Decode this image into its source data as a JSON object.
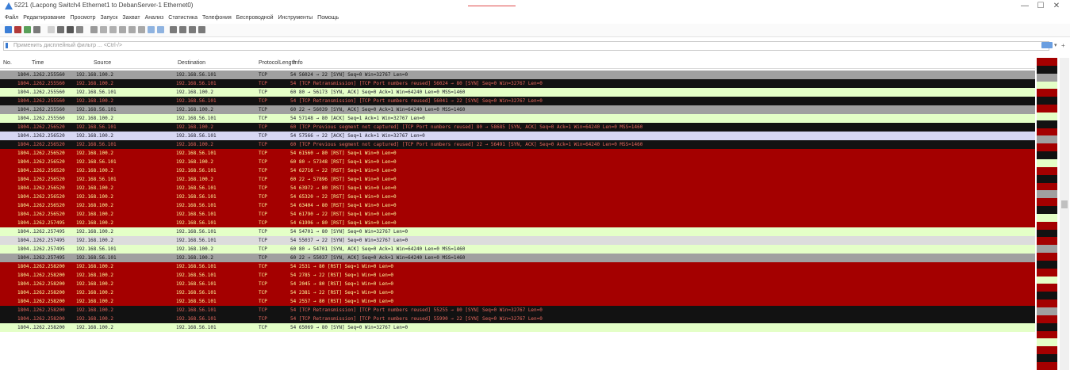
{
  "window": {
    "title": "5221 (Lacpong Switch4 Ethernet1 to DebanServer-1 Ethernet0)",
    "minimize": "—",
    "maximize": "☐",
    "close": "✕"
  },
  "menu": [
    "Файл",
    "Редактирование",
    "Просмотр",
    "Запуск",
    "Захват",
    "Анализ",
    "Статистика",
    "Телефония",
    "Беспроводной",
    "Инструменты",
    "Помощь"
  ],
  "filter": {
    "placeholder": "Применить дисплейный фильтр ... <Ctrl-/>",
    "apply_icon": "arrow-right-icon",
    "dropdown": "▾",
    "add": "+"
  },
  "columns": {
    "no": "No.",
    "time": "Time",
    "source": "Source",
    "destination": "Destination",
    "protocol": "Protocol",
    "length": "Length",
    "info": "Info"
  },
  "packets": [
    {
      "no": "1804..",
      "time": "1262.255560",
      "src": "192.168.100.2",
      "dst": "192.168.56.101",
      "proto": "TCP",
      "len": "",
      "info": "54 56024 → 22 [SYN] Seq=0 Win=32767 Len=0",
      "scheme": "gray"
    },
    {
      "no": "1804..",
      "time": "1262.255560",
      "src": "192.168.100.2",
      "dst": "192.168.56.101",
      "proto": "TCP",
      "len": "",
      "info": "54 [TCP Retransmission] [TCP Port numbers reused] 56024 → 80 [SYN] Seq=0 Win=32767 Len=0",
      "scheme": "black"
    },
    {
      "no": "1804..",
      "time": "1262.255560",
      "src": "192.168.56.101",
      "dst": "192.168.100.2",
      "proto": "TCP",
      "len": "",
      "info": "60 80 → 56173 [SYN, ACK] Seq=0 Ack=1 Win=64240 Len=0 MSS=1460",
      "scheme": "green"
    },
    {
      "no": "1804..",
      "time": "1262.255560",
      "src": "192.168.100.2",
      "dst": "192.168.56.101",
      "proto": "TCP",
      "len": "",
      "info": "54 [TCP Retransmission] [TCP Port numbers reused] 56041 → 22 [SYN] Seq=0 Win=32767 Len=0",
      "scheme": "black"
    },
    {
      "no": "1804..",
      "time": "1262.255560",
      "src": "192.168.56.101",
      "dst": "192.168.100.2",
      "proto": "TCP",
      "len": "",
      "info": "60 22 → 56039 [SYN, ACK] Seq=0 Ack=1 Win=64240 Len=0 MSS=1460",
      "scheme": "gray"
    },
    {
      "no": "1804..",
      "time": "1262.255560",
      "src": "192.168.100.2",
      "dst": "192.168.56.101",
      "proto": "TCP",
      "len": "",
      "info": "54 57148 → 80 [ACK] Seq=1 Ack=1 Win=32767 Len=0",
      "scheme": "green"
    },
    {
      "no": "1804..",
      "time": "1262.256520",
      "src": "192.168.56.101",
      "dst": "192.168.100.2",
      "proto": "TCP",
      "len": "",
      "info": "60 [TCP Previous segment not captured] [TCP Port numbers reused] 80 → 58685 [SYN, ACK] Seq=0 Ack=1 Win=64240 Len=0 MSS=1460",
      "scheme": "black"
    },
    {
      "no": "1804..",
      "time": "1262.256520",
      "src": "192.168.100.2",
      "dst": "192.168.56.101",
      "proto": "TCP",
      "len": "",
      "info": "54 57566 → 22 [ACK] Seq=1 Ack=1 Win=32767 Len=0",
      "scheme": "selected"
    },
    {
      "no": "1804..",
      "time": "1262.256520",
      "src": "192.168.56.101",
      "dst": "192.168.100.2",
      "proto": "TCP",
      "len": "",
      "info": "60 [TCP Previous segment not captured] [TCP Port numbers reused] 22 → 56491 [SYN, ACK] Seq=0 Ack=1 Win=64240 Len=0 MSS=1460",
      "scheme": "black"
    },
    {
      "no": "1804..",
      "time": "1262.256520",
      "src": "192.168.100.2",
      "dst": "192.168.56.101",
      "proto": "TCP",
      "len": "",
      "info": "54 61560 → 80 [RST] Seq=1 Win=0 Len=0",
      "scheme": "red"
    },
    {
      "no": "1804..",
      "time": "1262.256520",
      "src": "192.168.56.101",
      "dst": "192.168.100.2",
      "proto": "TCP",
      "len": "",
      "info": "60 80 → 57348 [RST] Seq=1 Win=0 Len=0",
      "scheme": "red"
    },
    {
      "no": "1804..",
      "time": "1262.256520",
      "src": "192.168.100.2",
      "dst": "192.168.56.101",
      "proto": "TCP",
      "len": "",
      "info": "54 62716 → 22 [RST] Seq=1 Win=0 Len=0",
      "scheme": "red"
    },
    {
      "no": "1804..",
      "time": "1262.256520",
      "src": "192.168.56.101",
      "dst": "192.168.100.2",
      "proto": "TCP",
      "len": "",
      "info": "60 22 → 57896 [RST] Seq=1 Win=0 Len=0",
      "scheme": "red"
    },
    {
      "no": "1804..",
      "time": "1262.256520",
      "src": "192.168.100.2",
      "dst": "192.168.56.101",
      "proto": "TCP",
      "len": "",
      "info": "54 63972 → 80 [RST] Seq=1 Win=0 Len=0",
      "scheme": "red"
    },
    {
      "no": "1804..",
      "time": "1262.256520",
      "src": "192.168.100.2",
      "dst": "192.168.56.101",
      "proto": "TCP",
      "len": "",
      "info": "54 65320 → 22 [RST] Seq=1 Win=0 Len=0",
      "scheme": "red"
    },
    {
      "no": "1804..",
      "time": "1262.256520",
      "src": "192.168.100.2",
      "dst": "192.168.56.101",
      "proto": "TCP",
      "len": "",
      "info": "54 63404 → 80 [RST] Seq=1 Win=0 Len=0",
      "scheme": "red"
    },
    {
      "no": "1804..",
      "time": "1262.256520",
      "src": "192.168.100.2",
      "dst": "192.168.56.101",
      "proto": "TCP",
      "len": "",
      "info": "54 61790 → 22 [RST] Seq=1 Win=0 Len=0",
      "scheme": "red"
    },
    {
      "no": "1804..",
      "time": "1262.257495",
      "src": "192.168.100.2",
      "dst": "192.168.56.101",
      "proto": "TCP",
      "len": "",
      "info": "54 61996 → 80 [RST] Seq=1 Win=0 Len=0",
      "scheme": "red"
    },
    {
      "no": "1804..",
      "time": "1262.257495",
      "src": "192.168.100.2",
      "dst": "192.168.56.101",
      "proto": "TCP",
      "len": "",
      "info": "54 54701 → 80 [SYN] Seq=0 Win=32767 Len=0",
      "scheme": "green"
    },
    {
      "no": "1804..",
      "time": "1262.257495",
      "src": "192.168.100.2",
      "dst": "192.168.56.101",
      "proto": "TCP",
      "len": "",
      "info": "54 55037 → 22 [SYN] Seq=0 Win=32767 Len=0",
      "scheme": "lightgray"
    },
    {
      "no": "1804..",
      "time": "1262.257495",
      "src": "192.168.56.101",
      "dst": "192.168.100.2",
      "proto": "TCP",
      "len": "",
      "info": "60 80 → 54701 [SYN, ACK] Seq=0 Ack=1 Win=64240 Len=0 MSS=1460",
      "scheme": "green"
    },
    {
      "no": "1804..",
      "time": "1262.257495",
      "src": "192.168.56.101",
      "dst": "192.168.100.2",
      "proto": "TCP",
      "len": "",
      "info": "60 22 → 55037 [SYN, ACK] Seq=0 Ack=1 Win=64240 Len=0 MSS=1460",
      "scheme": "gray"
    },
    {
      "no": "1804..",
      "time": "1262.258200",
      "src": "192.168.100.2",
      "dst": "192.168.56.101",
      "proto": "TCP",
      "len": "",
      "info": "54 2531 → 80 [RST] Seq=1 Win=0 Len=0",
      "scheme": "red"
    },
    {
      "no": "1804..",
      "time": "1262.258200",
      "src": "192.168.100.2",
      "dst": "192.168.56.101",
      "proto": "TCP",
      "len": "",
      "info": "54 2785 → 22 [RST] Seq=1 Win=0 Len=0",
      "scheme": "red"
    },
    {
      "no": "1804..",
      "time": "1262.258200",
      "src": "192.168.100.2",
      "dst": "192.168.56.101",
      "proto": "TCP",
      "len": "",
      "info": "54 2045 → 80 [RST] Seq=1 Win=0 Len=0",
      "scheme": "red"
    },
    {
      "no": "1804..",
      "time": "1262.258200",
      "src": "192.168.100.2",
      "dst": "192.168.56.101",
      "proto": "TCP",
      "len": "",
      "info": "54 2381 → 22 [RST] Seq=1 Win=0 Len=0",
      "scheme": "red"
    },
    {
      "no": "1804..",
      "time": "1262.258200",
      "src": "192.168.100.2",
      "dst": "192.168.56.101",
      "proto": "TCP",
      "len": "",
      "info": "54 2557 → 80 [RST] Seq=1 Win=0 Len=0",
      "scheme": "red"
    },
    {
      "no": "1804..",
      "time": "1262.258200",
      "src": "192.168.100.2",
      "dst": "192.168.56.101",
      "proto": "TCP",
      "len": "",
      "info": "54 [TCP Retransmission] [TCP Port numbers reused] 55255 → 80 [SYN] Seq=0 Win=32767 Len=0",
      "scheme": "black"
    },
    {
      "no": "1804..",
      "time": "1262.258200",
      "src": "192.168.100.2",
      "dst": "192.168.56.101",
      "proto": "TCP",
      "len": "",
      "info": "54 [TCP Retransmission] [TCP Port numbers reused] 55990 → 22 [SYN] Seq=0 Win=32767 Len=0",
      "scheme": "black"
    },
    {
      "no": "1804..",
      "time": "1262.258200",
      "src": "192.168.100.2",
      "dst": "192.168.56.101",
      "proto": "TCP",
      "len": "",
      "info": "54 65069 → 80 [SYN] Seq=0 Win=32767 Len=0",
      "scheme": "green"
    }
  ],
  "minimap_colors": [
    "#a40000",
    "#121212",
    "#a0a0a0",
    "#e4ffc7",
    "#a40000",
    "#121212",
    "#a40000",
    "#e4ffc7",
    "#121212",
    "#a40000",
    "#a0a0a0",
    "#a40000",
    "#121212",
    "#e4ffc7",
    "#a40000",
    "#121212",
    "#a40000",
    "#a0a0a0",
    "#a40000",
    "#121212",
    "#e4ffc7",
    "#a40000",
    "#121212",
    "#a40000",
    "#a0a0a0",
    "#a40000",
    "#121212",
    "#a40000",
    "#e4ffc7",
    "#a40000",
    "#121212",
    "#a40000",
    "#a0a0a0",
    "#a40000",
    "#121212",
    "#a40000",
    "#e4ffc7",
    "#a40000",
    "#121212",
    "#a40000"
  ]
}
